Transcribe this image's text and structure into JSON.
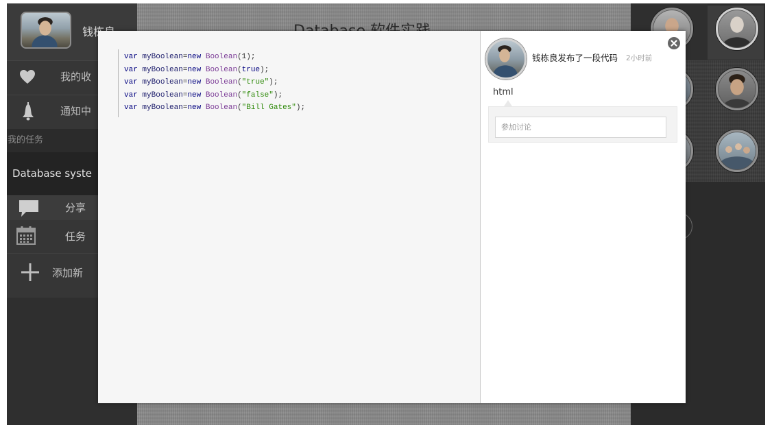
{
  "sidebar": {
    "user": {
      "name": "钱栋良"
    },
    "nav": [
      {
        "label": "我的收",
        "icon": "heart-icon"
      },
      {
        "label": "通知中",
        "icon": "bell-icon"
      }
    ],
    "section_title": "我的任务",
    "tasks": [
      {
        "label": "Database syste"
      }
    ],
    "actions": [
      {
        "label": "分享",
        "icon": "chat-bubble-icon"
      },
      {
        "label": "任务",
        "icon": "calendar-icon"
      },
      {
        "label": "添加新",
        "icon": "plus-icon"
      }
    ]
  },
  "stage": {
    "title": "Database 软件实践"
  },
  "modal": {
    "close_icon": "close-icon",
    "code": {
      "lines": [
        [
          {
            "t": "var",
            "color": "#00007f"
          },
          {
            "t": " myBoolean",
            "color": "#1c1c6b"
          },
          {
            "t": "=",
            "color": "#333333"
          },
          {
            "t": "new",
            "color": "#00007f"
          },
          {
            "t": " Boolean",
            "color": "#7b3b96"
          },
          {
            "t": "(",
            "color": "#333333"
          },
          {
            "t": "1",
            "color": "#333333"
          },
          {
            "t": ");",
            "color": "#333333"
          }
        ],
        [
          {
            "t": "var",
            "color": "#00007f"
          },
          {
            "t": " myBoolean",
            "color": "#1c1c6b"
          },
          {
            "t": "=",
            "color": "#333333"
          },
          {
            "t": "new",
            "color": "#00007f"
          },
          {
            "t": " Boolean",
            "color": "#7b3b96"
          },
          {
            "t": "(",
            "color": "#333333"
          },
          {
            "t": "true",
            "color": "#00007f"
          },
          {
            "t": ");",
            "color": "#333333"
          }
        ],
        [
          {
            "t": "var",
            "color": "#00007f"
          },
          {
            "t": " myBoolean",
            "color": "#1c1c6b"
          },
          {
            "t": "=",
            "color": "#333333"
          },
          {
            "t": "new",
            "color": "#00007f"
          },
          {
            "t": " Boolean",
            "color": "#7b3b96"
          },
          {
            "t": "(",
            "color": "#333333"
          },
          {
            "t": "\"true\"",
            "color": "#2f8a0a"
          },
          {
            "t": ");",
            "color": "#333333"
          }
        ],
        [
          {
            "t": "var",
            "color": "#00007f"
          },
          {
            "t": " myBoolean",
            "color": "#1c1c6b"
          },
          {
            "t": "=",
            "color": "#333333"
          },
          {
            "t": "new",
            "color": "#00007f"
          },
          {
            "t": " Boolean",
            "color": "#7b3b96"
          },
          {
            "t": "(",
            "color": "#333333"
          },
          {
            "t": "\"false\"",
            "color": "#2f8a0a"
          },
          {
            "t": ");",
            "color": "#333333"
          }
        ],
        [
          {
            "t": "var",
            "color": "#00007f"
          },
          {
            "t": " myBoolean",
            "color": "#1c1c6b"
          },
          {
            "t": "=",
            "color": "#333333"
          },
          {
            "t": "new",
            "color": "#00007f"
          },
          {
            "t": " Boolean",
            "color": "#7b3b96"
          },
          {
            "t": "(",
            "color": "#333333"
          },
          {
            "t": "\"Bill Gates\"",
            "color": "#2f8a0a"
          },
          {
            "t": ");",
            "color": "#333333"
          }
        ]
      ]
    },
    "post": {
      "headline": "钱栋良发布了一段代码",
      "time": "2小时前",
      "language": "html"
    },
    "comment": {
      "placeholder": "参加讨论"
    }
  },
  "colors": {
    "sidebar_bg": "#2f2f2f",
    "stage_bg": "#8a8a8a",
    "modal_code_bg": "#f6f6f6",
    "close_button": "#666666"
  }
}
